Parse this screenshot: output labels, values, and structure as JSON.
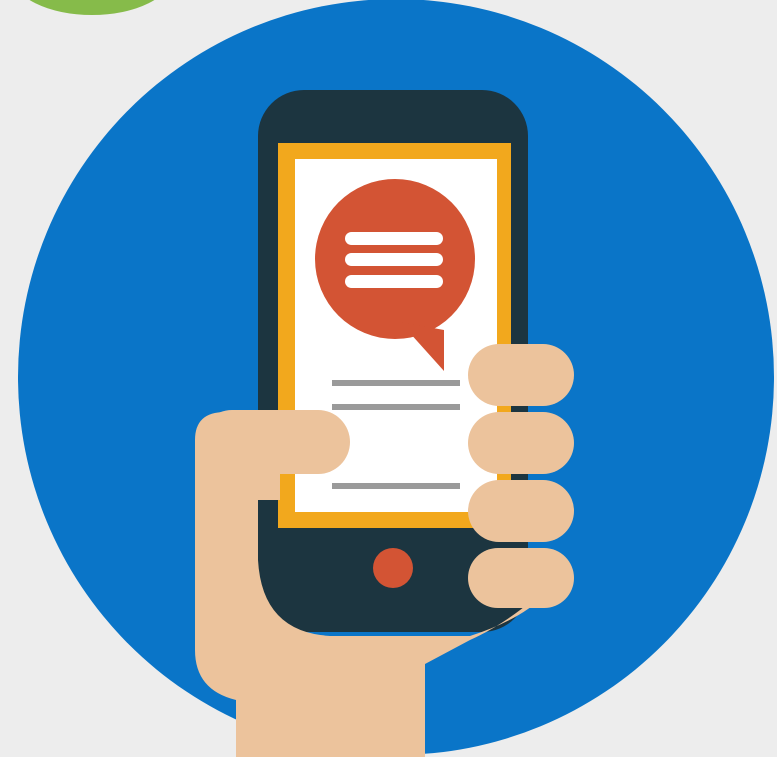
{
  "illustration": {
    "subject": "hand-holding-smartphone-with-chat-bubble",
    "icons": [
      "chat-bubble-icon",
      "smartphone-icon",
      "hand-icon"
    ]
  },
  "colors": {
    "background": "#ededed",
    "circle": "#0a75c8",
    "green_accent": "#86bb4a",
    "phone_body": "#1c3540",
    "screen_border": "#f2a81d",
    "screen": "#ffffff",
    "chat_bubble": "#d35434",
    "text_lines": "#9a9a9a",
    "home_button": "#d35434",
    "skin": "#ecc39c"
  }
}
